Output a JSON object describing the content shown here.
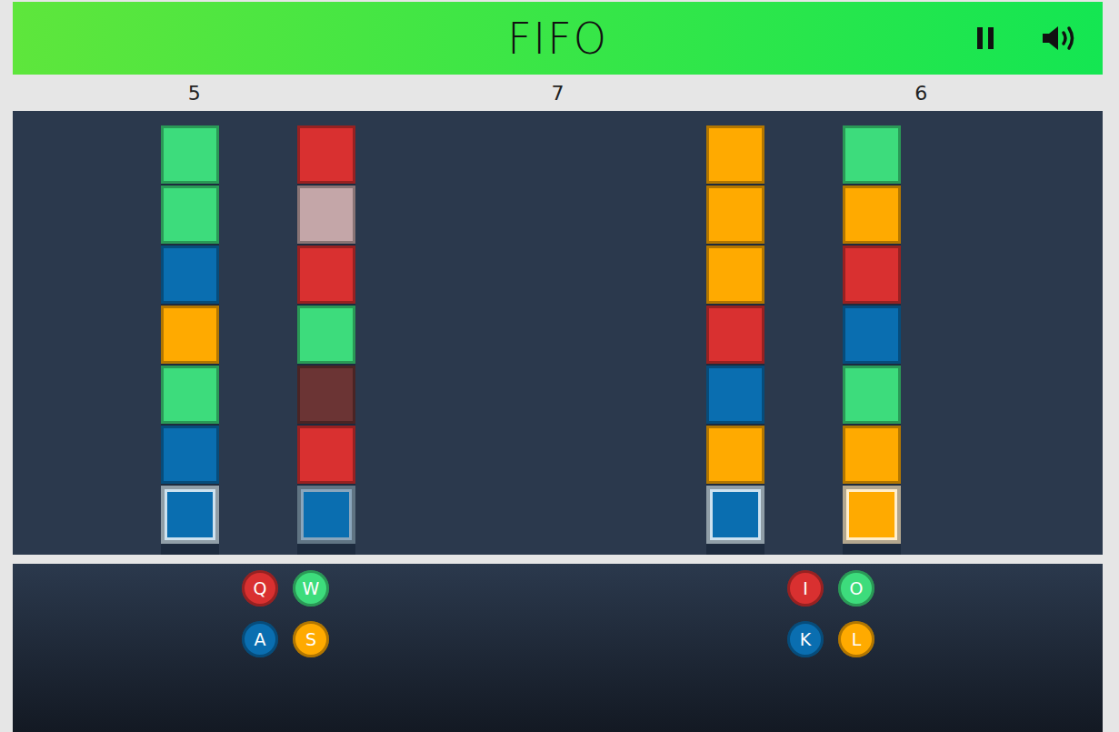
{
  "header": {
    "title": "FIFO"
  },
  "scores": [
    "5",
    "7",
    "6"
  ],
  "players": [
    {
      "columns": [
        {
          "cells": [
            {
              "color": "#3ddc7c",
              "selected": false,
              "faded": false
            },
            {
              "color": "#3ddc7c",
              "selected": false,
              "faded": false
            },
            {
              "color": "#0a6eb0",
              "selected": false,
              "faded": false
            },
            {
              "color": "#ffaa00",
              "selected": false,
              "faded": false
            },
            {
              "color": "#3ddc7c",
              "selected": false,
              "faded": false
            },
            {
              "color": "#0a6eb0",
              "selected": false,
              "faded": false
            },
            {
              "color": "#0a6eb0",
              "selected": true,
              "faded": false
            }
          ]
        },
        {
          "cells": [
            {
              "color": "#d93030",
              "selected": false,
              "faded": false
            },
            {
              "color": "#c4a6a8",
              "selected": false,
              "faded": false
            },
            {
              "color": "#d93030",
              "selected": false,
              "faded": false
            },
            {
              "color": "#3ddc7c",
              "selected": false,
              "faded": false
            },
            {
              "color": "#6b3434",
              "selected": false,
              "faded": false
            },
            {
              "color": "#d93030",
              "selected": false,
              "faded": false
            },
            {
              "color": "#0a6eb0",
              "selected": false,
              "faded": true
            }
          ]
        }
      ],
      "keys": [
        {
          "label": "Q",
          "color": "#d93030"
        },
        {
          "label": "W",
          "color": "#3ddc7c"
        },
        {
          "label": "A",
          "color": "#0a6eb0"
        },
        {
          "label": "S",
          "color": "#ffaa00"
        }
      ]
    },
    {
      "columns": [
        {
          "cells": [
            {
              "color": "#ffaa00",
              "selected": false,
              "faded": false
            },
            {
              "color": "#ffaa00",
              "selected": false,
              "faded": false
            },
            {
              "color": "#ffaa00",
              "selected": false,
              "faded": false
            },
            {
              "color": "#d93030",
              "selected": false,
              "faded": false
            },
            {
              "color": "#0a6eb0",
              "selected": false,
              "faded": false
            },
            {
              "color": "#ffaa00",
              "selected": false,
              "faded": false
            },
            {
              "color": "#0a6eb0",
              "selected": true,
              "faded": false
            }
          ]
        },
        {
          "cells": [
            {
              "color": "#3ddc7c",
              "selected": false,
              "faded": false
            },
            {
              "color": "#ffaa00",
              "selected": false,
              "faded": false
            },
            {
              "color": "#d93030",
              "selected": false,
              "faded": false
            },
            {
              "color": "#0a6eb0",
              "selected": false,
              "faded": false
            },
            {
              "color": "#3ddc7c",
              "selected": false,
              "faded": false
            },
            {
              "color": "#ffaa00",
              "selected": false,
              "faded": false
            },
            {
              "color": "#ffaa00",
              "selected": true,
              "faded": false
            }
          ]
        }
      ],
      "keys": [
        {
          "label": "I",
          "color": "#d93030"
        },
        {
          "label": "O",
          "color": "#3ddc7c"
        },
        {
          "label": "K",
          "color": "#0a6eb0"
        },
        {
          "label": "L",
          "color": "#ffaa00"
        }
      ]
    }
  ]
}
